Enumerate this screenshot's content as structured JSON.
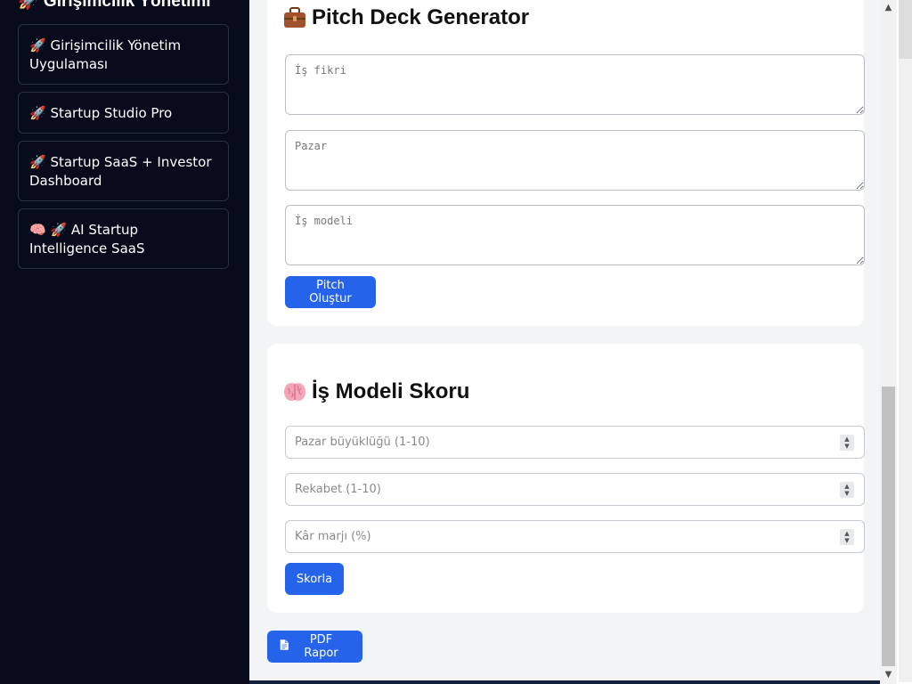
{
  "sidebar": {
    "title": "🚀 Girişimcilik Yönetimi",
    "items": [
      {
        "label": "🚀 Girişimcilik Yönetim Uygulaması"
      },
      {
        "label": "🚀 Startup Studio Pro"
      },
      {
        "label": "🚀 Startup SaaS + Investor Dashboard"
      },
      {
        "label": "🧠 🚀 AI Startup Intelligence SaaS"
      }
    ]
  },
  "pitch_deck": {
    "title": "Pitch Deck Generator",
    "icon": "briefcase-icon",
    "fields": [
      {
        "placeholder": "İş fikri",
        "value": ""
      },
      {
        "placeholder": "Pazar",
        "value": ""
      },
      {
        "placeholder": "İş modeli",
        "value": ""
      }
    ],
    "button_label": "Pitch Oluştur"
  },
  "business_model": {
    "title": "İş Modeli Skoru",
    "icon": "brain-icon",
    "fields": [
      {
        "placeholder": "Pazar büyüklüğü (1-10)",
        "value": ""
      },
      {
        "placeholder": "Rekabet (1-10)",
        "value": ""
      },
      {
        "placeholder": "Kâr marjı (%)",
        "value": ""
      }
    ],
    "button_label": "Skorla"
  },
  "pdf_button": {
    "label": "PDF Rapor",
    "icon": "document-icon"
  },
  "colors": {
    "sidebar_bg": "#070b1c",
    "accent": "#2563eb",
    "main_bg": "#f3f4f6",
    "card_bg": "#ffffff"
  }
}
